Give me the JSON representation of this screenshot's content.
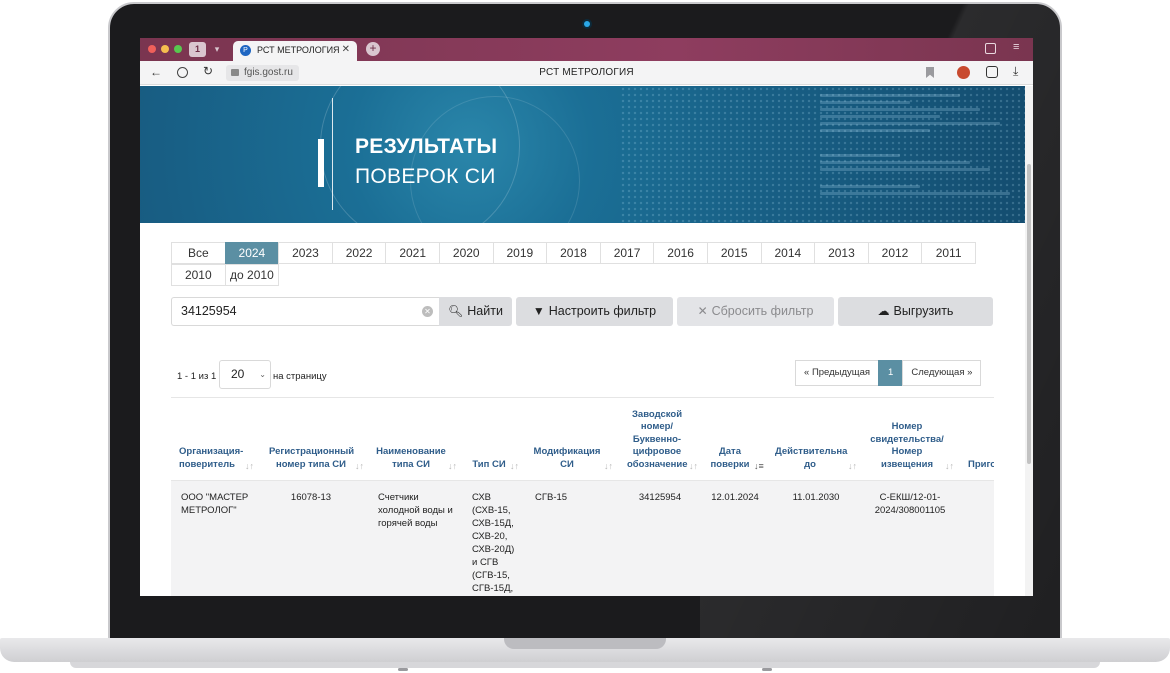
{
  "browser": {
    "tab_counter": "1",
    "tab_title": "РСТ МЕТРОЛОГИЯ",
    "tab_favicon_text": "Р",
    "url": "fgis.gost.ru",
    "page_title": "РСТ МЕТРОЛОГИЯ"
  },
  "banner": {
    "line1": "РЕЗУЛЬТАТЫ",
    "line2": "ПОВЕРОК СИ"
  },
  "years": {
    "active": "2024",
    "row1": [
      "Все",
      "2024",
      "2023",
      "2022",
      "2021",
      "2020",
      "2019",
      "2018",
      "2017",
      "2016",
      "2015",
      "2014",
      "2013",
      "2012",
      "2011"
    ],
    "row2": [
      "2010",
      "до 2010"
    ]
  },
  "search": {
    "value": "34125954",
    "find_label": "Найти",
    "filter_label": "Настроить фильтр",
    "reset_label": "Сбросить фильтр",
    "export_label": "Выгрузить"
  },
  "pagination": {
    "count_text": "1 - 1 из 1",
    "per_page": "20",
    "per_page_label": "на страницу",
    "prev_label": "Предыдущая",
    "current_page": "1",
    "next_label": "Следующая"
  },
  "table": {
    "headers": {
      "org": "Организация-\nповеритель",
      "reg": "Регистрационный\nномер типа СИ",
      "name": "Наименование\nтипа СИ",
      "type": "Тип СИ",
      "mod": "Модификация\nСИ",
      "serial": "Заводской\nномер/\nБуквенно-\nцифровое\nобозначение",
      "date": "Дата\nповерки",
      "valid": "Действительна\nдо",
      "cert": "Номер\nсвидетельства/\nНомер\nизвещения",
      "fit": "Приго"
    },
    "rows": [
      {
        "org": "ООО \"МАСТЕР\nМЕТРОЛОГ\"",
        "reg": "16078-13",
        "name": "Счетчики\nхолодной воды и\nгорячей воды",
        "type": "СХВ\n(СХВ-15,\nСХВ-15Д,\nСХВ-20,\nСХВ-20Д)\nи СГВ\n(СГВ-15,\nСГВ-15Д,",
        "mod": "СГВ-15",
        "serial": "34125954",
        "date": "12.01.2024",
        "valid": "11.01.2030",
        "cert": "С-ЕКШ/12-01-\n2024/308001105"
      }
    ]
  },
  "colors": {
    "accent": "#5b8fa3",
    "header_text": "#2f5d8a",
    "tab_bar": "#8e3d5f",
    "banner": "#1b6f96"
  },
  "icons": [
    "back-arrow-icon",
    "shield-icon",
    "reload-icon",
    "lock-icon",
    "bookmark-icon",
    "search-icon",
    "filter-icon",
    "close-icon",
    "cloud-upload-icon",
    "sort-icon"
  ]
}
